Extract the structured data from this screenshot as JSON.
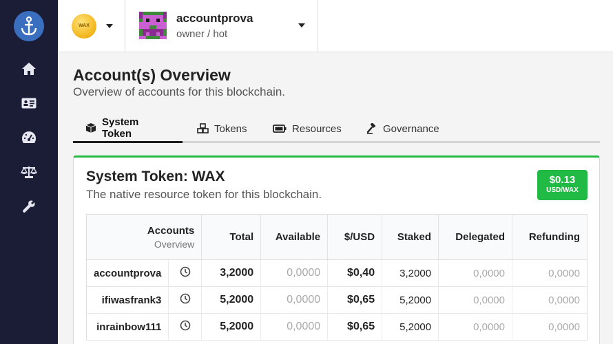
{
  "sidebar": {
    "items": [
      {
        "name": "home-icon"
      },
      {
        "name": "id-card-icon"
      },
      {
        "name": "dashboard-gauge-icon"
      },
      {
        "name": "balance-scale-icon"
      },
      {
        "name": "wrench-icon"
      }
    ]
  },
  "header": {
    "chain_icon": "wax-coin-icon",
    "chain_coin_text": "WAX",
    "account": {
      "name": "accountprova",
      "permission": "owner / hot"
    }
  },
  "page": {
    "title": "Account(s) Overview",
    "subtitle": "Overview of accounts for this blockchain."
  },
  "tabs": [
    {
      "label": "System Token",
      "icon": "cube-icon",
      "active": true
    },
    {
      "label": "Tokens",
      "icon": "cubes-icon",
      "active": false
    },
    {
      "label": "Resources",
      "icon": "battery-icon",
      "active": false
    },
    {
      "label": "Governance",
      "icon": "gavel-icon",
      "active": false
    }
  ],
  "card": {
    "title": "System Token: WAX",
    "subtitle": "The native resource token for this blockchain.",
    "price": {
      "value": "$0.13",
      "unit": "USD/WAX"
    }
  },
  "table": {
    "headers": {
      "accounts": "Accounts",
      "accounts_sub": "Overview",
      "total": "Total",
      "available": "Available",
      "usd": "$/USD",
      "staked": "Staked",
      "delegated": "Delegated",
      "refunding": "Refunding"
    },
    "rows": [
      {
        "account": "accountprova",
        "total": "3,2000",
        "available": "0,0000",
        "usd": "$0,40",
        "staked": "3,2000",
        "delegated": "0,0000",
        "refunding": "0,0000"
      },
      {
        "account": "ifiwasfrank3",
        "total": "5,2000",
        "available": "0,0000",
        "usd": "$0,65",
        "staked": "5,2000",
        "delegated": "0,0000",
        "refunding": "0,0000"
      },
      {
        "account": "inrainbow111",
        "total": "5,2000",
        "available": "0,0000",
        "usd": "$0,65",
        "staked": "5,2000",
        "delegated": "0,0000",
        "refunding": "0,0000"
      }
    ]
  },
  "colors": {
    "sidebar_bg": "#1b1c36",
    "accent_green": "#21ba45",
    "logo_blue": "#3a6fc0"
  }
}
